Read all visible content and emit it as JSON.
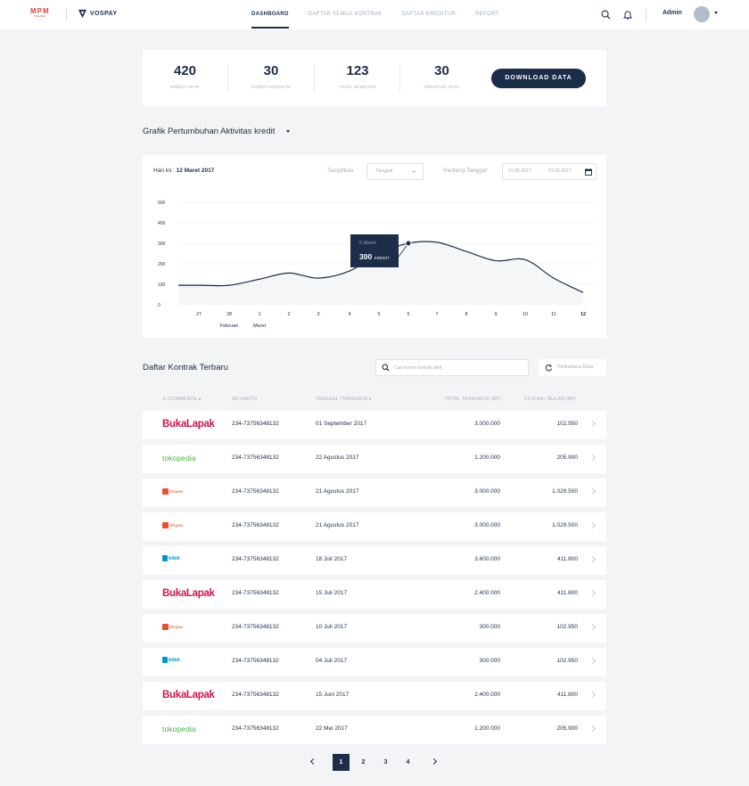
{
  "nav": {
    "brand1": "MPM",
    "brand1_sub": "FINANCE",
    "brand2": "VOSPAY",
    "menu": [
      "DASHBOARD",
      "DAFTAR SEMUA KONTRAK",
      "DAFTAR KREDITUR",
      "REPORT"
    ],
    "active_menu": "DASHBOARD",
    "user": "Admin"
  },
  "stats": [
    {
      "value": "420",
      "label": "KREDIT AKTIF"
    },
    {
      "value": "30",
      "label": "KREDIT NONAKTIF"
    },
    {
      "value": "123",
      "label": "TOTAL KREDITUR"
    },
    {
      "value": "30",
      "label": "KREDITUR AKTIF"
    }
  ],
  "download_label": "DOWNLOAD DATA",
  "chart_section": {
    "title": "Grafik Pertumbuhan Aktivitas kredit",
    "today_label": "Hari ini : ",
    "today_value": "12 Maret 2017",
    "tampilkan_label": "Tampilkan",
    "tampilkan_value": "Tanggal",
    "rentang_label": "Rentang Tanggal",
    "date_from": "01-05-2017",
    "date_sep": "-",
    "date_to": "01-06-2017"
  },
  "chart_data": {
    "type": "area",
    "x": [
      "27",
      "28",
      "1",
      "2",
      "3",
      "4",
      "5",
      "6",
      "7",
      "8",
      "9",
      "10",
      "11",
      "12"
    ],
    "x_month_labels": [
      {
        "at": "28",
        "text": "Februari"
      },
      {
        "at": "1",
        "text": "Maret"
      }
    ],
    "values": [
      95,
      95,
      125,
      155,
      130,
      165,
      250,
      300,
      305,
      260,
      215,
      220,
      130,
      60
    ],
    "yticks": [
      0,
      100,
      200,
      300,
      400,
      500
    ],
    "ylim": [
      0,
      500
    ],
    "grid": true,
    "highlight": {
      "x": "6",
      "date": "6 Maret",
      "value": "300",
      "unit": "KREDIT"
    },
    "line_color": "#1c2d4a",
    "fill_color": "#f4f6f8"
  },
  "table": {
    "title": "Daftar Kontrak Terbaru",
    "search_placeholder": "Cari nomor kontrak aktif",
    "refresh_label": "Perbaharui Data",
    "headers": [
      "E-COMMERCE",
      "NO KARTU",
      "TANGGAL TRANSAKSI",
      "TOTAL TRANSAKSI (RP)",
      "CICILAN / BULAN (RP)"
    ],
    "rows": [
      {
        "store": "BukaLapak",
        "store_key": "bukalapak",
        "card": "234-73756348132",
        "date": "01 September 2017",
        "total": "3.000.000",
        "cicilan": "102.950"
      },
      {
        "store": "tokopedia",
        "store_key": "tokopedia",
        "card": "234-73756348132",
        "date": "22 Agustus 2017",
        "total": "1.200.000",
        "cicilan": "205.900"
      },
      {
        "store": "Shopee",
        "store_key": "shopee",
        "card": "234-73756348132",
        "date": "21 Agustus 2017",
        "total": "3.000.000",
        "cicilan": "1.029.500"
      },
      {
        "store": "Shopee",
        "store_key": "shopee",
        "card": "234-73756348132",
        "date": "21 Agustus 2017",
        "total": "3.000.000",
        "cicilan": "1.029.500"
      },
      {
        "store": "blibli",
        "store_key": "blibli",
        "card": "234-73756348132",
        "date": "18 Juli 2017",
        "total": "3.600.000",
        "cicilan": "411.800"
      },
      {
        "store": "BukaLapak",
        "store_key": "bukalapak",
        "card": "234-73756348132",
        "date": "15 Juli 2017",
        "total": "2.400.000",
        "cicilan": "411.800"
      },
      {
        "store": "Shopee",
        "store_key": "shopee",
        "card": "234-73756348132",
        "date": "10 Juli 2017",
        "total": "300.000",
        "cicilan": "102.950"
      },
      {
        "store": "blibli",
        "store_key": "blibli",
        "card": "234-73756348132",
        "date": "04 Juli 2017",
        "total": "300.000",
        "cicilan": "102.950"
      },
      {
        "store": "BukaLapak",
        "store_key": "bukalapak",
        "card": "234-73756348132",
        "date": "15 Juni 2017",
        "total": "2.400.000",
        "cicilan": "411.800"
      },
      {
        "store": "tokopedia",
        "store_key": "tokopedia",
        "card": "234-73756348132",
        "date": "22 Mei 2017",
        "total": "1.200.000",
        "cicilan": "205.900"
      }
    ]
  },
  "pagination": {
    "pages": [
      "1",
      "2",
      "3",
      "4"
    ],
    "active": "1"
  }
}
